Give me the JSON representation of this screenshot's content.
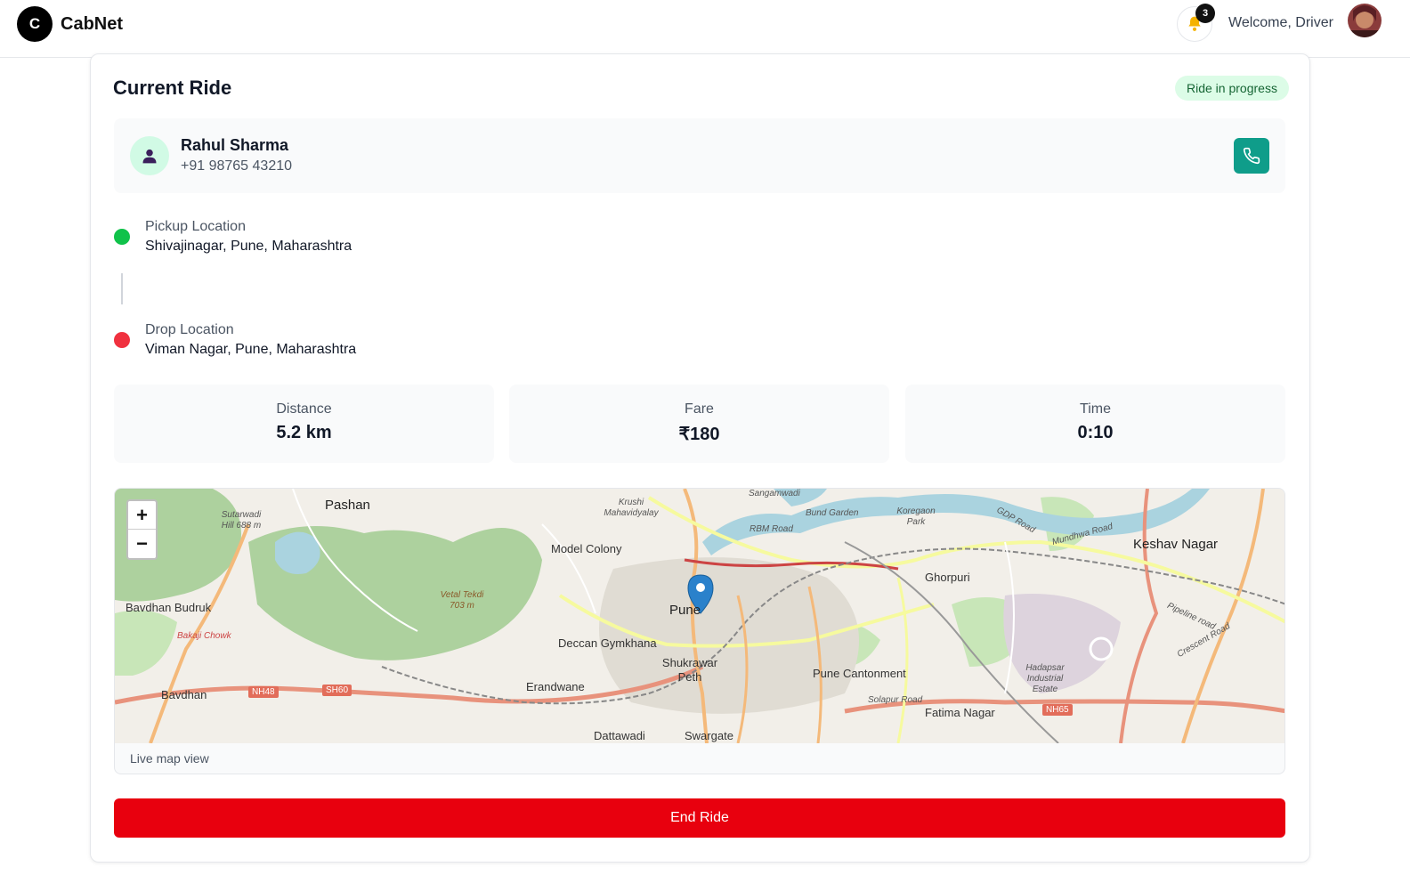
{
  "header": {
    "logo_letter": "C",
    "brand": "CabNet",
    "notification_count": "3",
    "welcome": "Welcome, Driver"
  },
  "ride": {
    "title": "Current Ride",
    "status": "Ride in progress",
    "rider": {
      "name": "Rahul Sharma",
      "phone": "+91 98765 43210"
    },
    "pickup": {
      "label": "Pickup Location",
      "value": "Shivajinagar, Pune, Maharashtra"
    },
    "drop": {
      "label": "Drop Location",
      "value": "Viman Nagar, Pune, Maharashtra"
    },
    "stats": {
      "distance": {
        "label": "Distance",
        "value": "5.2 km"
      },
      "fare": {
        "label": "Fare",
        "value": "₹180"
      },
      "time": {
        "label": "Time",
        "value": "0:10"
      }
    }
  },
  "map": {
    "zoom_in": "+",
    "zoom_out": "−",
    "caption": "Live map view",
    "labels": {
      "pashan": "Pashan",
      "krushi": "Krushi Mahavidyalay",
      "sangamwadi": "Sangamwadi",
      "bund_garden": "Bund Garden",
      "koregaon": "Koregaon Park",
      "gdp_road": "GDP Road",
      "mundhwa_road": "Mundhwa Road",
      "keshav": "Keshav Nagar",
      "sutarwadi": "Sutarwadi Hill 688 m",
      "model_colony": "Model Colony",
      "rbm_road": "RBM Road",
      "ghorpuri": "Ghorpuri",
      "pune": "Pune",
      "vetal": "Vetal Tekdi 703 m",
      "bavdhan_budruk": "Bavdhan Budruk",
      "bakaji": "Bakaji Chowk",
      "deccan": "Deccan Gymkhana",
      "shukrawar": "Shukrawar Peth",
      "pune_cantonment": "Pune Cantonment",
      "hadapsar": "Hadapsar Industrial Estate",
      "pipeline": "Pipeline road",
      "crescent": "Crescent Road",
      "bavdhan": "Bavdhan",
      "erandwane": "Erandwane",
      "fatima": "Fatima Nagar",
      "solapur_road": "Solapur Road",
      "dattawadi": "Dattawadi",
      "swargate": "Swargate",
      "nh48": "NH48",
      "sh60": "SH60",
      "nh65": "NH65"
    }
  },
  "actions": {
    "end_ride": "End Ride"
  },
  "colors": {
    "accent_green": "#0f9d8a",
    "end_red": "#e8000e",
    "pickup_dot": "#10c24a",
    "drop_dot": "#f0313f"
  }
}
